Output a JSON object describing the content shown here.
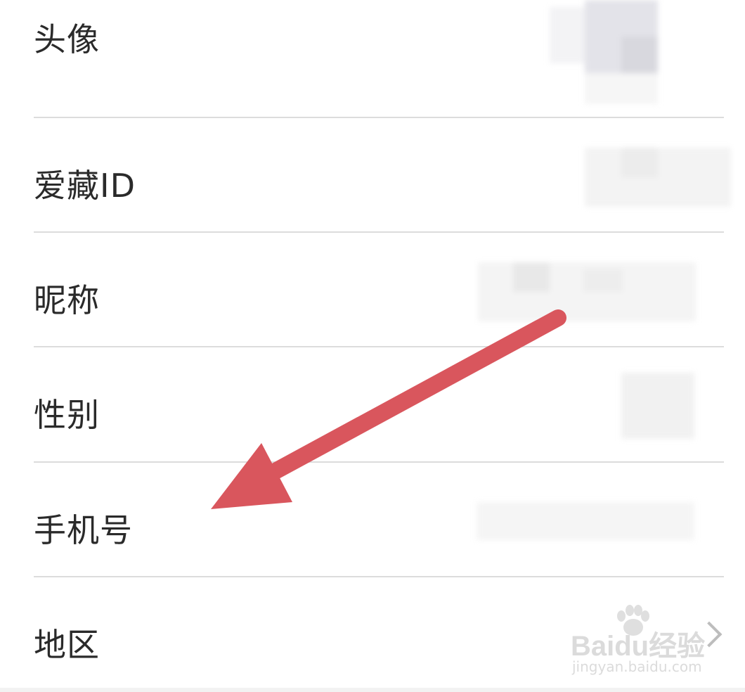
{
  "profile_rows": [
    {
      "label": "头像"
    },
    {
      "label": "爱藏ID"
    },
    {
      "label": "昵称"
    },
    {
      "label": "性别"
    },
    {
      "label": "手机号"
    },
    {
      "label": "地区"
    }
  ],
  "watermark": {
    "brand": "Baidu经验",
    "url": "jingyan.baidu.com"
  },
  "colors": {
    "arrow": "#d9565d",
    "divider": "#dcdcdc",
    "text": "#2a2a2a"
  },
  "icons": {
    "region_chevron": "chevron-right-icon",
    "annotation": "red-arrow-icon"
  }
}
